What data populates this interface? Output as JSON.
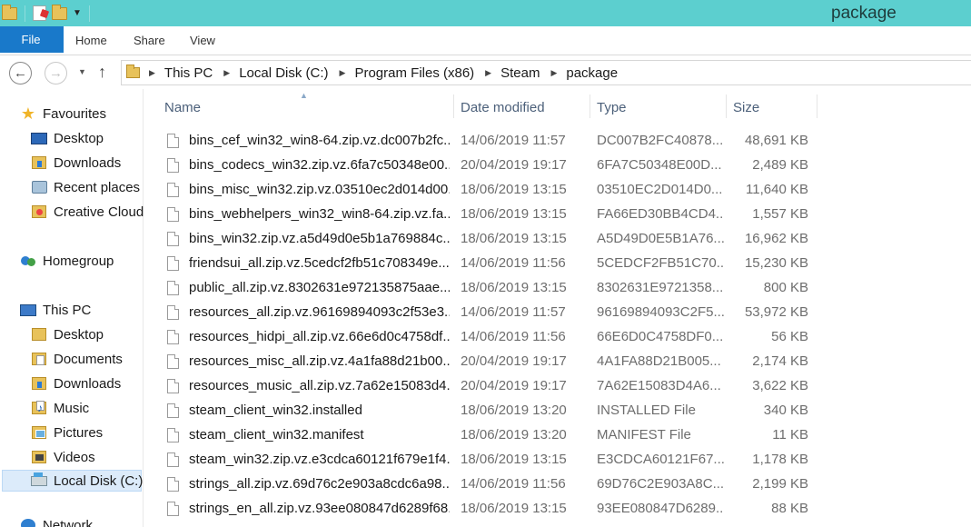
{
  "window": {
    "title": "package"
  },
  "ribbon": {
    "tabs": [
      "File",
      "Home",
      "Share",
      "View"
    ]
  },
  "address": {
    "crumbs": [
      "This PC",
      "Local Disk (C:)",
      "Program Files (x86)",
      "Steam",
      "package"
    ]
  },
  "nav_pane": {
    "favourites": {
      "label": "Favourites",
      "items": [
        "Desktop",
        "Downloads",
        "Recent places",
        "Creative Cloud"
      ]
    },
    "homegroup": "Homegroup",
    "this_pc": {
      "label": "This PC",
      "items": [
        "Desktop",
        "Documents",
        "Downloads",
        "Music",
        "Pictures",
        "Videos",
        "Local Disk (C:)"
      ]
    },
    "network": "Network"
  },
  "columns": {
    "name": "Name",
    "date": "Date modified",
    "type": "Type",
    "size": "Size"
  },
  "files": [
    {
      "name": "bins_cef_win32_win8-64.zip.vz.dc007b2fc...",
      "date": "14/06/2019 11:57",
      "type": "DC007B2FC40878...",
      "size": "48,691 KB"
    },
    {
      "name": "bins_codecs_win32.zip.vz.6fa7c50348e00...",
      "date": "20/04/2019 19:17",
      "type": "6FA7C50348E00D...",
      "size": "2,489 KB"
    },
    {
      "name": "bins_misc_win32.zip.vz.03510ec2d014d00...",
      "date": "18/06/2019 13:15",
      "type": "03510EC2D014D0...",
      "size": "11,640 KB"
    },
    {
      "name": "bins_webhelpers_win32_win8-64.zip.vz.fa...",
      "date": "18/06/2019 13:15",
      "type": "FA66ED30BB4CD4...",
      "size": "1,557 KB"
    },
    {
      "name": "bins_win32.zip.vz.a5d49d0e5b1a769884c...",
      "date": "18/06/2019 13:15",
      "type": "A5D49D0E5B1A76...",
      "size": "16,962 KB"
    },
    {
      "name": "friendsui_all.zip.vz.5cedcf2fb51c708349e...",
      "date": "14/06/2019 11:56",
      "type": "5CEDCF2FB51C70...",
      "size": "15,230 KB"
    },
    {
      "name": "public_all.zip.vz.8302631e972135875aae...",
      "date": "18/06/2019 13:15",
      "type": "8302631E9721358...",
      "size": "800 KB"
    },
    {
      "name": "resources_all.zip.vz.96169894093c2f53e3...",
      "date": "14/06/2019 11:57",
      "type": "96169894093C2F5...",
      "size": "53,972 KB"
    },
    {
      "name": "resources_hidpi_all.zip.vz.66e6d0c4758df...",
      "date": "14/06/2019 11:56",
      "type": "66E6D0C4758DF0...",
      "size": "56 KB"
    },
    {
      "name": "resources_misc_all.zip.vz.4a1fa88d21b00...",
      "date": "20/04/2019 19:17",
      "type": "4A1FA88D21B005...",
      "size": "2,174 KB"
    },
    {
      "name": "resources_music_all.zip.vz.7a62e15083d4...",
      "date": "20/04/2019 19:17",
      "type": "7A62E15083D4A6...",
      "size": "3,622 KB"
    },
    {
      "name": "steam_client_win32.installed",
      "date": "18/06/2019 13:20",
      "type": "INSTALLED File",
      "size": "340 KB"
    },
    {
      "name": "steam_client_win32.manifest",
      "date": "18/06/2019 13:20",
      "type": "MANIFEST File",
      "size": "11 KB"
    },
    {
      "name": "steam_win32.zip.vz.e3cdca60121f679e1f4...",
      "date": "18/06/2019 13:15",
      "type": "E3CDCA60121F67...",
      "size": "1,178 KB"
    },
    {
      "name": "strings_all.zip.vz.69d76c2e903a8cdc6a98...",
      "date": "14/06/2019 11:56",
      "type": "69D76C2E903A8C...",
      "size": "2,199 KB"
    },
    {
      "name": "strings_en_all.zip.vz.93ee080847d6289f68...",
      "date": "18/06/2019 13:15",
      "type": "93EE080847D6289...",
      "size": "88 KB"
    }
  ]
}
